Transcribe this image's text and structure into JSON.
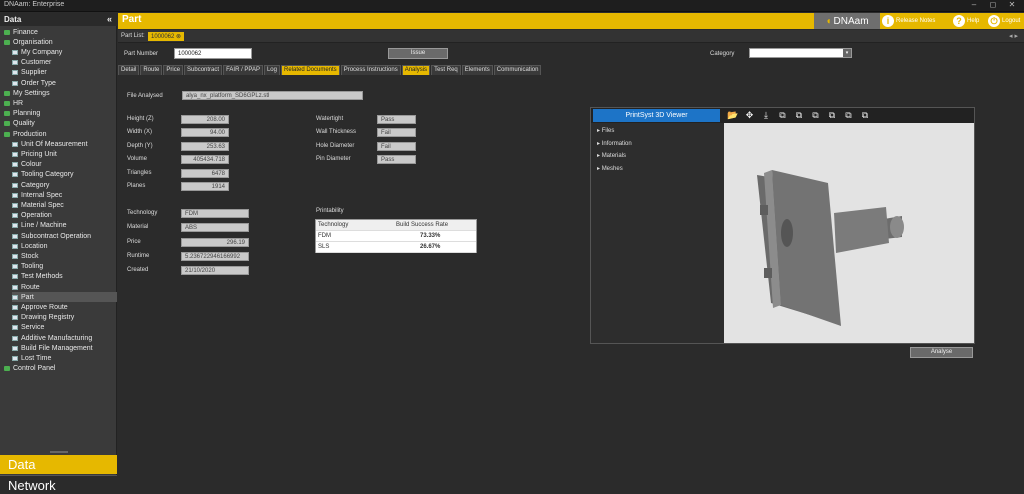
{
  "window": {
    "title": "DNAam: Enterprise",
    "controls": [
      "–",
      "◻",
      "✕"
    ]
  },
  "sidebar": {
    "header": "Data",
    "collapse": "«",
    "items": [
      {
        "label": "Finance",
        "type": "folder",
        "level": 0
      },
      {
        "label": "Organisation",
        "type": "folder",
        "level": 0
      },
      {
        "label": "My Company",
        "type": "item",
        "level": 1
      },
      {
        "label": "Customer",
        "type": "item",
        "level": 1
      },
      {
        "label": "Supplier",
        "type": "item",
        "level": 1
      },
      {
        "label": "Order Type",
        "type": "item",
        "level": 1
      },
      {
        "label": "My Settings",
        "type": "folder",
        "level": 0
      },
      {
        "label": "HR",
        "type": "folder",
        "level": 0
      },
      {
        "label": "Planning",
        "type": "folder",
        "level": 0
      },
      {
        "label": "Quality",
        "type": "folder",
        "level": 0
      },
      {
        "label": "Production",
        "type": "folder",
        "level": 0
      },
      {
        "label": "Unit Of Measurement",
        "type": "item",
        "level": 1
      },
      {
        "label": "Pricing Unit",
        "type": "item",
        "level": 1
      },
      {
        "label": "Colour",
        "type": "item",
        "level": 1
      },
      {
        "label": "Tooling Category",
        "type": "item",
        "level": 1
      },
      {
        "label": "Category",
        "type": "item",
        "level": 1
      },
      {
        "label": "Internal Spec",
        "type": "item",
        "level": 1
      },
      {
        "label": "Material Spec",
        "type": "item",
        "level": 1
      },
      {
        "label": "Operation",
        "type": "item",
        "level": 1
      },
      {
        "label": "Line / Machine",
        "type": "item",
        "level": 1
      },
      {
        "label": "Subcontract Operation",
        "type": "item",
        "level": 1
      },
      {
        "label": "Location",
        "type": "item",
        "level": 1
      },
      {
        "label": "Stock",
        "type": "item",
        "level": 1
      },
      {
        "label": "Tooling",
        "type": "item",
        "level": 1
      },
      {
        "label": "Test Methods",
        "type": "item",
        "level": 1
      },
      {
        "label": "Route",
        "type": "item",
        "level": 1
      },
      {
        "label": "Part",
        "type": "item",
        "level": 1,
        "selected": true
      },
      {
        "label": "Approve Route",
        "type": "item",
        "level": 1
      },
      {
        "label": "Drawing Registry",
        "type": "item",
        "level": 1
      },
      {
        "label": "Service",
        "type": "item",
        "level": 1
      },
      {
        "label": "Additive Manufacturing",
        "type": "item",
        "level": 1
      },
      {
        "label": "Build File Management",
        "type": "item",
        "level": 1
      },
      {
        "label": "Lost Time",
        "type": "item",
        "level": 1
      },
      {
        "label": "Control Panel",
        "type": "folder",
        "level": 0
      }
    ],
    "nav": {
      "data": "Data",
      "network": "Network"
    }
  },
  "header": {
    "title": "Part",
    "logo": "DNAam",
    "release_notes": "Release Notes",
    "help": "Help",
    "logout": "Logout"
  },
  "partlist": {
    "label": "Part List:",
    "tab": "1000062",
    "arrows": "◂ ▸"
  },
  "form": {
    "part_number_label": "Part Number",
    "part_number": "1000062",
    "issue_button": "Issue",
    "category_label": "Category",
    "category_value": ""
  },
  "tabs": [
    "Detail",
    "Route",
    "Price",
    "Subcontract",
    "FAIR / PPAP",
    "Log",
    "Related Documents",
    "Process Instructions",
    "Analysis",
    "Test Req",
    "Elements",
    "Communication"
  ],
  "highlighted_tabs": [
    6,
    8
  ],
  "analysis": {
    "file_label": "File Analysed",
    "file": "alya_nx_platform_SD6GPLz.stl",
    "dims": [
      {
        "label": "Height (Z)",
        "value": "208.00"
      },
      {
        "label": "Width (X)",
        "value": "94.00"
      },
      {
        "label": "Depth (Y)",
        "value": "253.63"
      },
      {
        "label": "Volume",
        "value": "405434.718"
      },
      {
        "label": "Triangles",
        "value": "6478"
      },
      {
        "label": "Planes",
        "value": "1914"
      }
    ],
    "checks": [
      {
        "label": "Watertight",
        "value": "Pass"
      },
      {
        "label": "Wall Thickness",
        "value": "Fail"
      },
      {
        "label": "Hole Diameter",
        "value": "Fail"
      },
      {
        "label": "Pin Diameter",
        "value": "Pass"
      }
    ],
    "tech": [
      {
        "label": "Technology",
        "value": "FDM"
      },
      {
        "label": "Material",
        "value": "ABS"
      },
      {
        "label": "Price",
        "value": "296.19"
      },
      {
        "label": "Runtime",
        "value": "5.236722946166992"
      },
      {
        "label": "Created",
        "value": "21/10/2020"
      }
    ],
    "printability": {
      "title": "Printability",
      "headers": [
        "Technology",
        "Build Success Rate"
      ],
      "rows": [
        [
          "FDM",
          "73.33%"
        ],
        [
          "SLS",
          "26.67%"
        ]
      ]
    }
  },
  "viewer": {
    "title": "PrintSyst 3D Viewer",
    "panel": [
      "Files",
      "Information",
      "Materials",
      "Meshes"
    ],
    "toolbar_icons": [
      "folder-icon",
      "move-icon",
      "download-icon",
      "cube-front-icon",
      "cube-back-icon",
      "cube-left-icon",
      "cube-right-icon",
      "cube-top-icon",
      "cube-bottom-icon"
    ]
  },
  "analyse_button": "Analyse",
  "colors": {
    "accent": "#e6b800",
    "viewer_title": "#1d74c7",
    "folder_icon": "#4caf50"
  }
}
